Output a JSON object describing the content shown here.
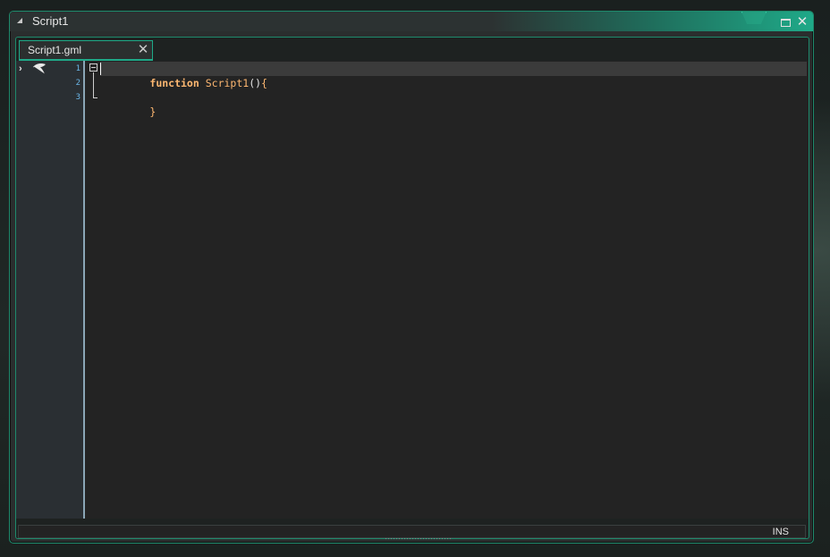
{
  "window": {
    "title": "Script1"
  },
  "tab": {
    "label": "Script1.gml"
  },
  "editor": {
    "line_numbers": [
      "1",
      "2",
      "3"
    ],
    "lines": [
      {
        "keyword": "function",
        "name": "Script1",
        "parens": "()",
        "brace": "{"
      },
      {
        "text": ""
      },
      {
        "brace": "}"
      }
    ]
  },
  "statusbar": {
    "mode": "INS"
  },
  "colors": {
    "accent": "#1fa988",
    "keyword": "#ffb871",
    "line_number": "#6bb7e8",
    "gutter": "#2a2f33"
  }
}
